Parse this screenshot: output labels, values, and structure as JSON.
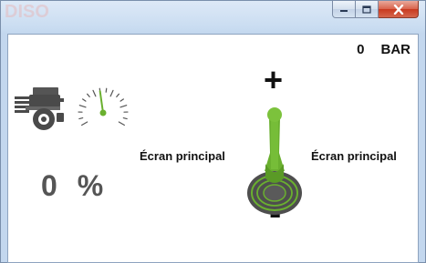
{
  "window": {
    "buttons": {
      "minimize": "minimize-icon",
      "maximize": "maximize-icon",
      "close": "close-icon"
    }
  },
  "pressure": {
    "value": "0",
    "unit": "BAR"
  },
  "engine": {
    "icon": "engine-icon"
  },
  "gauge": {
    "icon": "speedometer-icon",
    "needle_fraction": 0.5
  },
  "throttle": {
    "value": "0",
    "unit": "%"
  },
  "joystick": {
    "icon": "joystick-icon",
    "plus_label": "+",
    "minus_label": "-",
    "left_label": "Écran principal",
    "right_label": "Écran principal",
    "accent_color": "#6ab02f"
  },
  "colors": {
    "readout_gray": "#555555",
    "text_dark": "#111111"
  }
}
